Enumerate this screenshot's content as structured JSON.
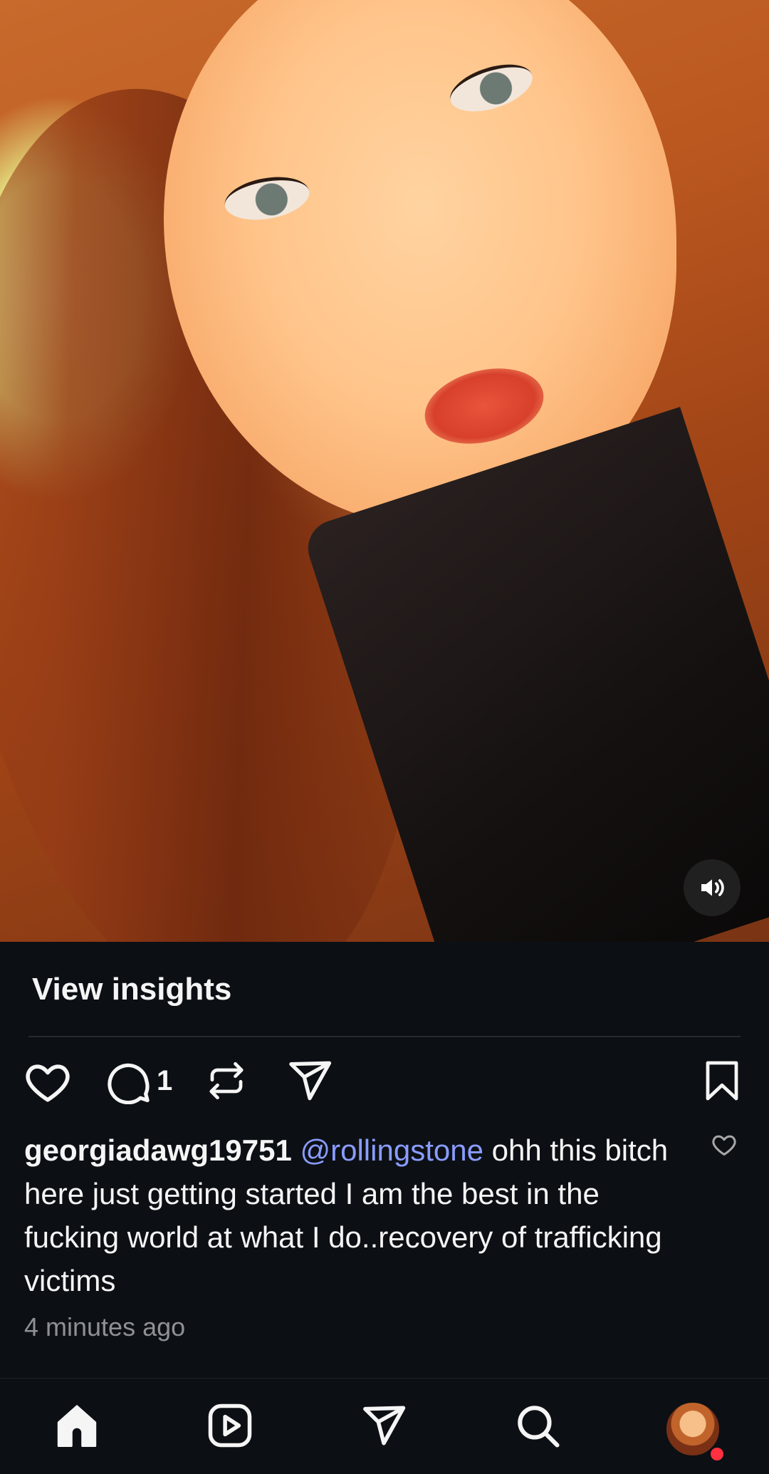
{
  "post": {
    "media": {
      "type": "video",
      "description_icon": "mute-toggle"
    },
    "insights_label": "View insights",
    "actions": {
      "comment_count": "1"
    },
    "caption": {
      "username": "georgiadawg19751",
      "mention": "@rollingstone",
      "text": " ohh this bitch here just getting started I am the best in the fucking world at what I do..recovery of trafficking victims"
    },
    "timestamp": "4 minutes ago"
  },
  "navbar": {
    "items": [
      "home-icon",
      "reels-icon",
      "direct-icon",
      "search-icon",
      "profile-avatar"
    ],
    "active": "home",
    "notification_dot_color": "#ff3040"
  },
  "colors": {
    "background": "#0c1014",
    "mention": "#8a9cff",
    "secondary_text": "#8e9094"
  }
}
